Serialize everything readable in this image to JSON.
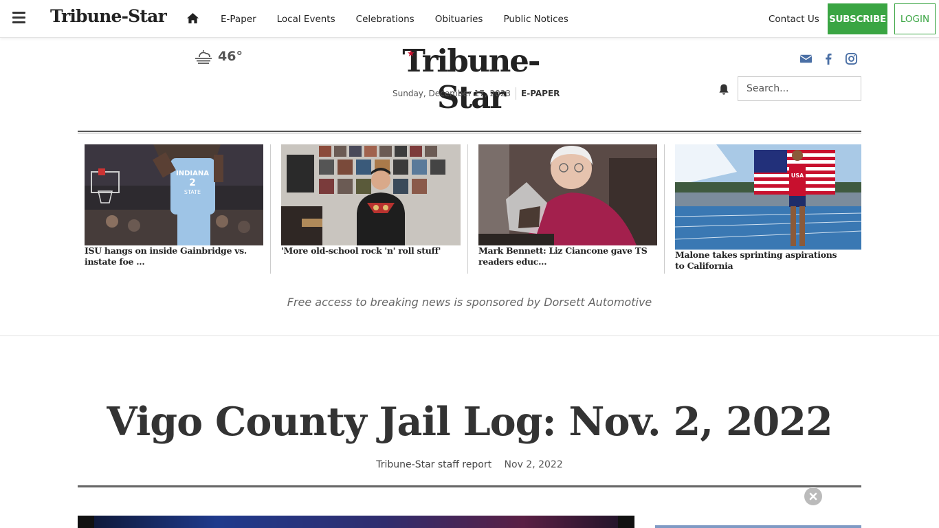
{
  "nav": {
    "brand": "Tribune-Star",
    "links": [
      "E-Paper",
      "Local Events",
      "Celebrations",
      "Obituaries",
      "Public Notices"
    ],
    "contact": "Contact Us",
    "subscribe": "SUBSCRIBE",
    "login": "LOGIN"
  },
  "masthead": {
    "logo": "Tribune-Star",
    "temperature": "46°",
    "date": "Sunday, December 17, 2023",
    "epaper": "E-PAPER",
    "search_placeholder": "Search..."
  },
  "stories": [
    {
      "caption": "ISU hangs on inside Gainbridge vs. instate foe ..."
    },
    {
      "caption": "'More old-school rock 'n' roll stuff'"
    },
    {
      "caption": "Mark Bennett: Liz Ciancone gave TS readers educ..."
    },
    {
      "caption": "Malone takes sprinting aspirations to California"
    }
  ],
  "sponsor": "Free access to breaking news is sponsored by Dorsett Automotive",
  "article": {
    "headline": "Vigo County Jail Log: Nov. 2, 2022",
    "author": "Tribune-Star staff report",
    "date": "Nov 2, 2022"
  },
  "colors": {
    "subscribe_green": "#3aa543",
    "star_red": "#c8102e",
    "social_blue": "#4a6fa5"
  }
}
